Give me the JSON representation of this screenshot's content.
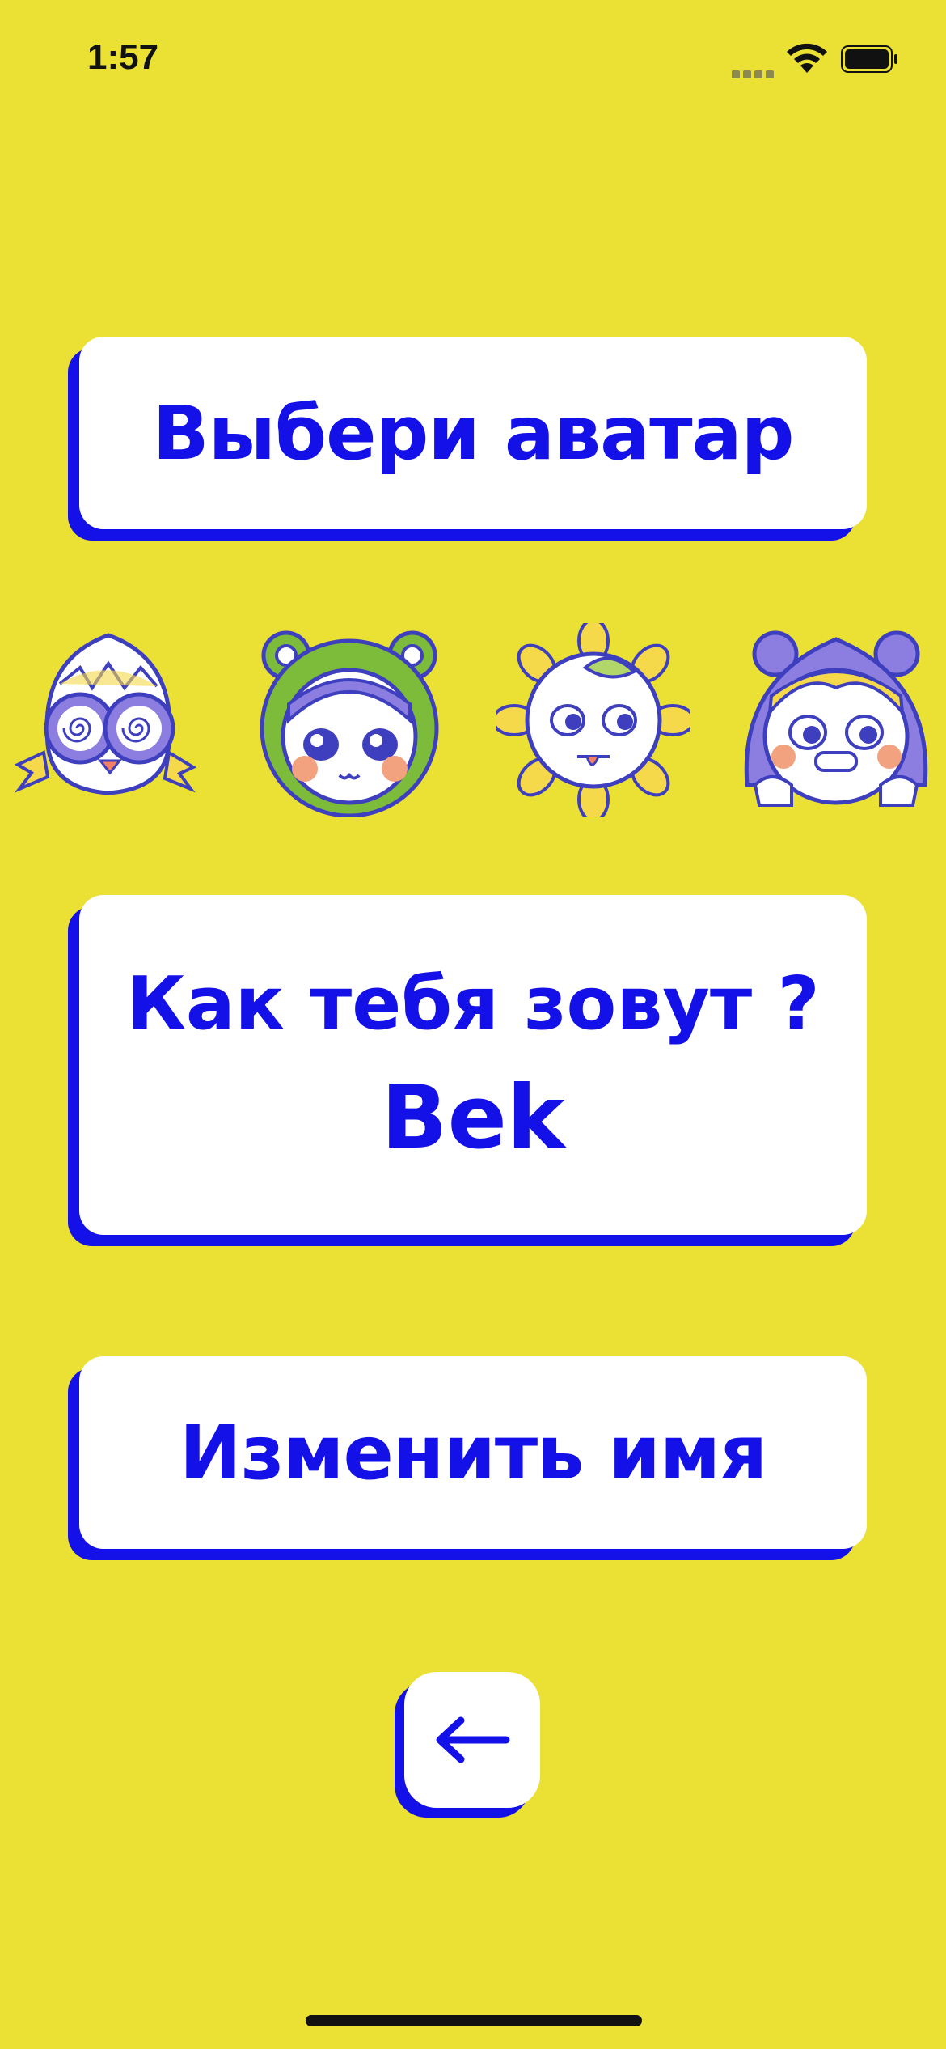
{
  "status": {
    "time": "1:57"
  },
  "buttons": {
    "choose_avatar": "Выбери аватар",
    "name_question": "Как тебя зовут ?",
    "name_value": "Bek",
    "change_name": "Изменить имя"
  },
  "avatars": [
    {
      "name": "egg-chick-avatar"
    },
    {
      "name": "frog-hood-avatar"
    },
    {
      "name": "sunflower-avatar"
    },
    {
      "name": "bear-hood-avatar"
    }
  ],
  "colors": {
    "background": "#ebe034",
    "accent": "#1411e8",
    "card": "#ffffff"
  },
  "icons": {
    "back": "arrow-left-icon",
    "wifi": "wifi-icon",
    "battery": "battery-icon"
  }
}
